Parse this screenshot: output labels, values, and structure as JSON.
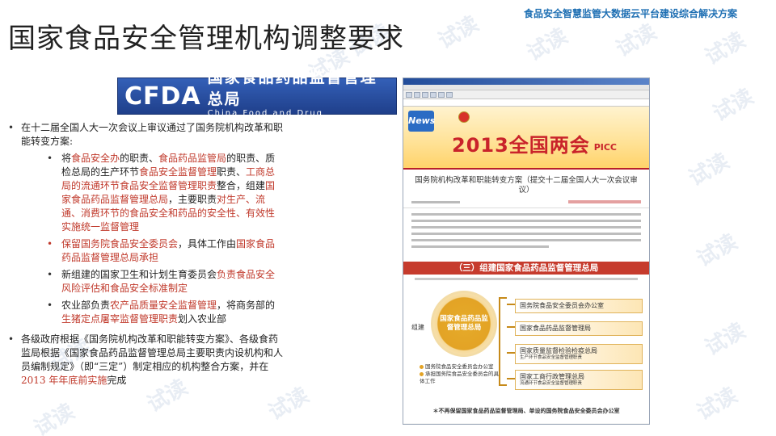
{
  "header": {
    "tag": "食品安全智慧监管大数据云平台建设综合解决方案",
    "title": "国家食品安全管理机构调整要求"
  },
  "logo": {
    "mark": "CFDA",
    "cn": "国家食品药品监督管理总局",
    "en": "China Food and Drug Administration"
  },
  "bullets": {
    "b1": {
      "text": "在十二届全国人大一次会议上审议通过了国务院机构改革和职能转变方案:",
      "sub": [
        {
          "t1": "将",
          "h1": "食品安全办",
          "t2": "的职责、",
          "h2": "食品药品监管局",
          "t3": "的职责、质检总局的生产环节",
          "h3": "食品安全监督管理",
          "t4": "职责、",
          "h4": "工商总局的流通环节食品安全监督管理职责",
          "t5": "整合，组建",
          "h5": "国家食品药品监督管理总局",
          "t6": "，主要职责",
          "h6": "对生产、流通、消费环节的食品安全和药品的安全性、有效性实施统一监督管理"
        },
        {
          "h1": "保留国务院食品安全委员会",
          "t1": "，具体工作由",
          "h2": "国家食品药品监督管理总局承担"
        },
        {
          "t1": "新组建的国家卫生和计划生育委员会",
          "h1": "负责食品安全风险评估和食品安全标准制定"
        },
        {
          "t1": "农业部负责",
          "h1": "农产品质量安全监督管理",
          "t2": "，将商务部的",
          "h2": "生猪定点屠宰监督管理职责",
          "t3": "划入农业部"
        }
      ]
    },
    "b2": {
      "t1": "各级政府根据《国务院机构改革和职能转变方案》、各级食药监局根据《国家食品药品监督管理总局主要职责内设机构和人员编制规定》（即“三定”）制定相应的机构整合方案，并在",
      "h1": "2013 年年底前实施",
      "t2": "完成"
    }
  },
  "screenshot": {
    "news_logo": "News",
    "banner_heading": "2013全国两会",
    "picc": "PICC",
    "article_title": "国务院机构改革和职能转变方案（提交十二届全国人大一次会议审议）",
    "section_bar": "（三）组建国家食品药品监督管理总局",
    "center_circle": "国家食品药品监督管理总局",
    "zujian": "组建",
    "boxes": [
      {
        "title": "国务院食品安全委员会办公室",
        "note": ""
      },
      {
        "title": "国家食品药品监督管理局",
        "note": ""
      },
      {
        "title": "国家质量监督检验检疫总局",
        "note": "生产环节食品安全监督管理职责"
      },
      {
        "title": "国家工商行政管理总局",
        "note": "流通环节食品安全监督管理职责"
      }
    ],
    "under_circle_1": "国务院食品安全委员会办公室",
    "under_circle_2": "承担国务院食品安全委员会的具体工作",
    "footnote": "＊不再保留国家食品药品监督管理局、单设的国务院食品安全委员会办公室"
  },
  "watermark": "试读"
}
